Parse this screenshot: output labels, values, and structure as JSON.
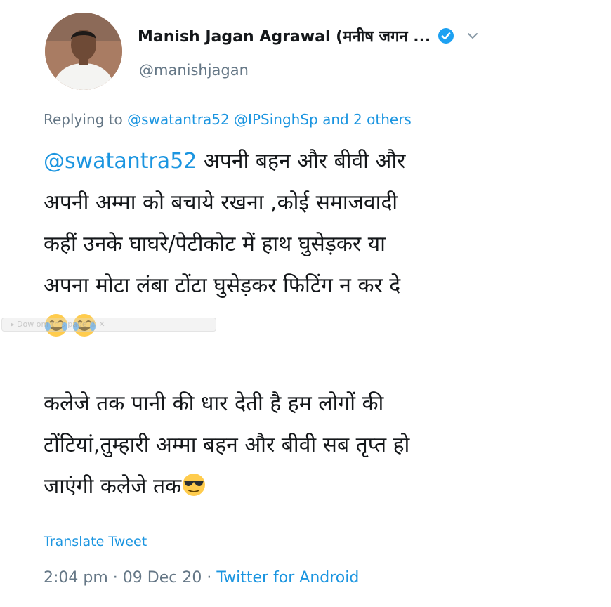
{
  "author": {
    "display_name": "Manish Jagan Agrawal (मनीष जगन ...",
    "handle": "@manishjagan",
    "verified_icon": "verified-badge-icon",
    "menu_icon": "chevron-down-icon"
  },
  "reply": {
    "prefix": "Replying to ",
    "mentions": "@swatantra52 @IPSinghSp",
    "suffix": " and 2 others"
  },
  "body": {
    "mention": "@swatantra52",
    "line1_rest": "  अपनी बहन और बीवी और",
    "line2": "अपनी अम्मा को बचाये रखना ,कोई समाजवादी",
    "line3": "कहीं उनके घाघरे/पेटीकोट में हाथ घुसेड़कर या",
    "line4": "अपना मोटा लंबा टोंटा घुसेड़कर फिटिंग न कर दे",
    "line5": "कलेजे तक पानी की धार देती है हम लोगों की",
    "line6": "टोंटियां,तुम्हारी अम्मा बहन और बीवी सब तृप्त हो",
    "line7": "जाएंगी कलेजे तक",
    "emoji_laugh": "tears-of-joy-emoji",
    "emoji_cool": "sunglasses-emoji"
  },
  "overlay_text": "▸ Dow         om this page   ②  ✕",
  "translate_label": "Translate Tweet",
  "meta": {
    "time": "2:04 pm",
    "separator": " · ",
    "date": "09 Dec 20",
    "separator2": " · ",
    "source": "Twitter for Android"
  },
  "colors": {
    "link": "#1b95e0",
    "secondary": "#657786",
    "text": "#14171a"
  }
}
